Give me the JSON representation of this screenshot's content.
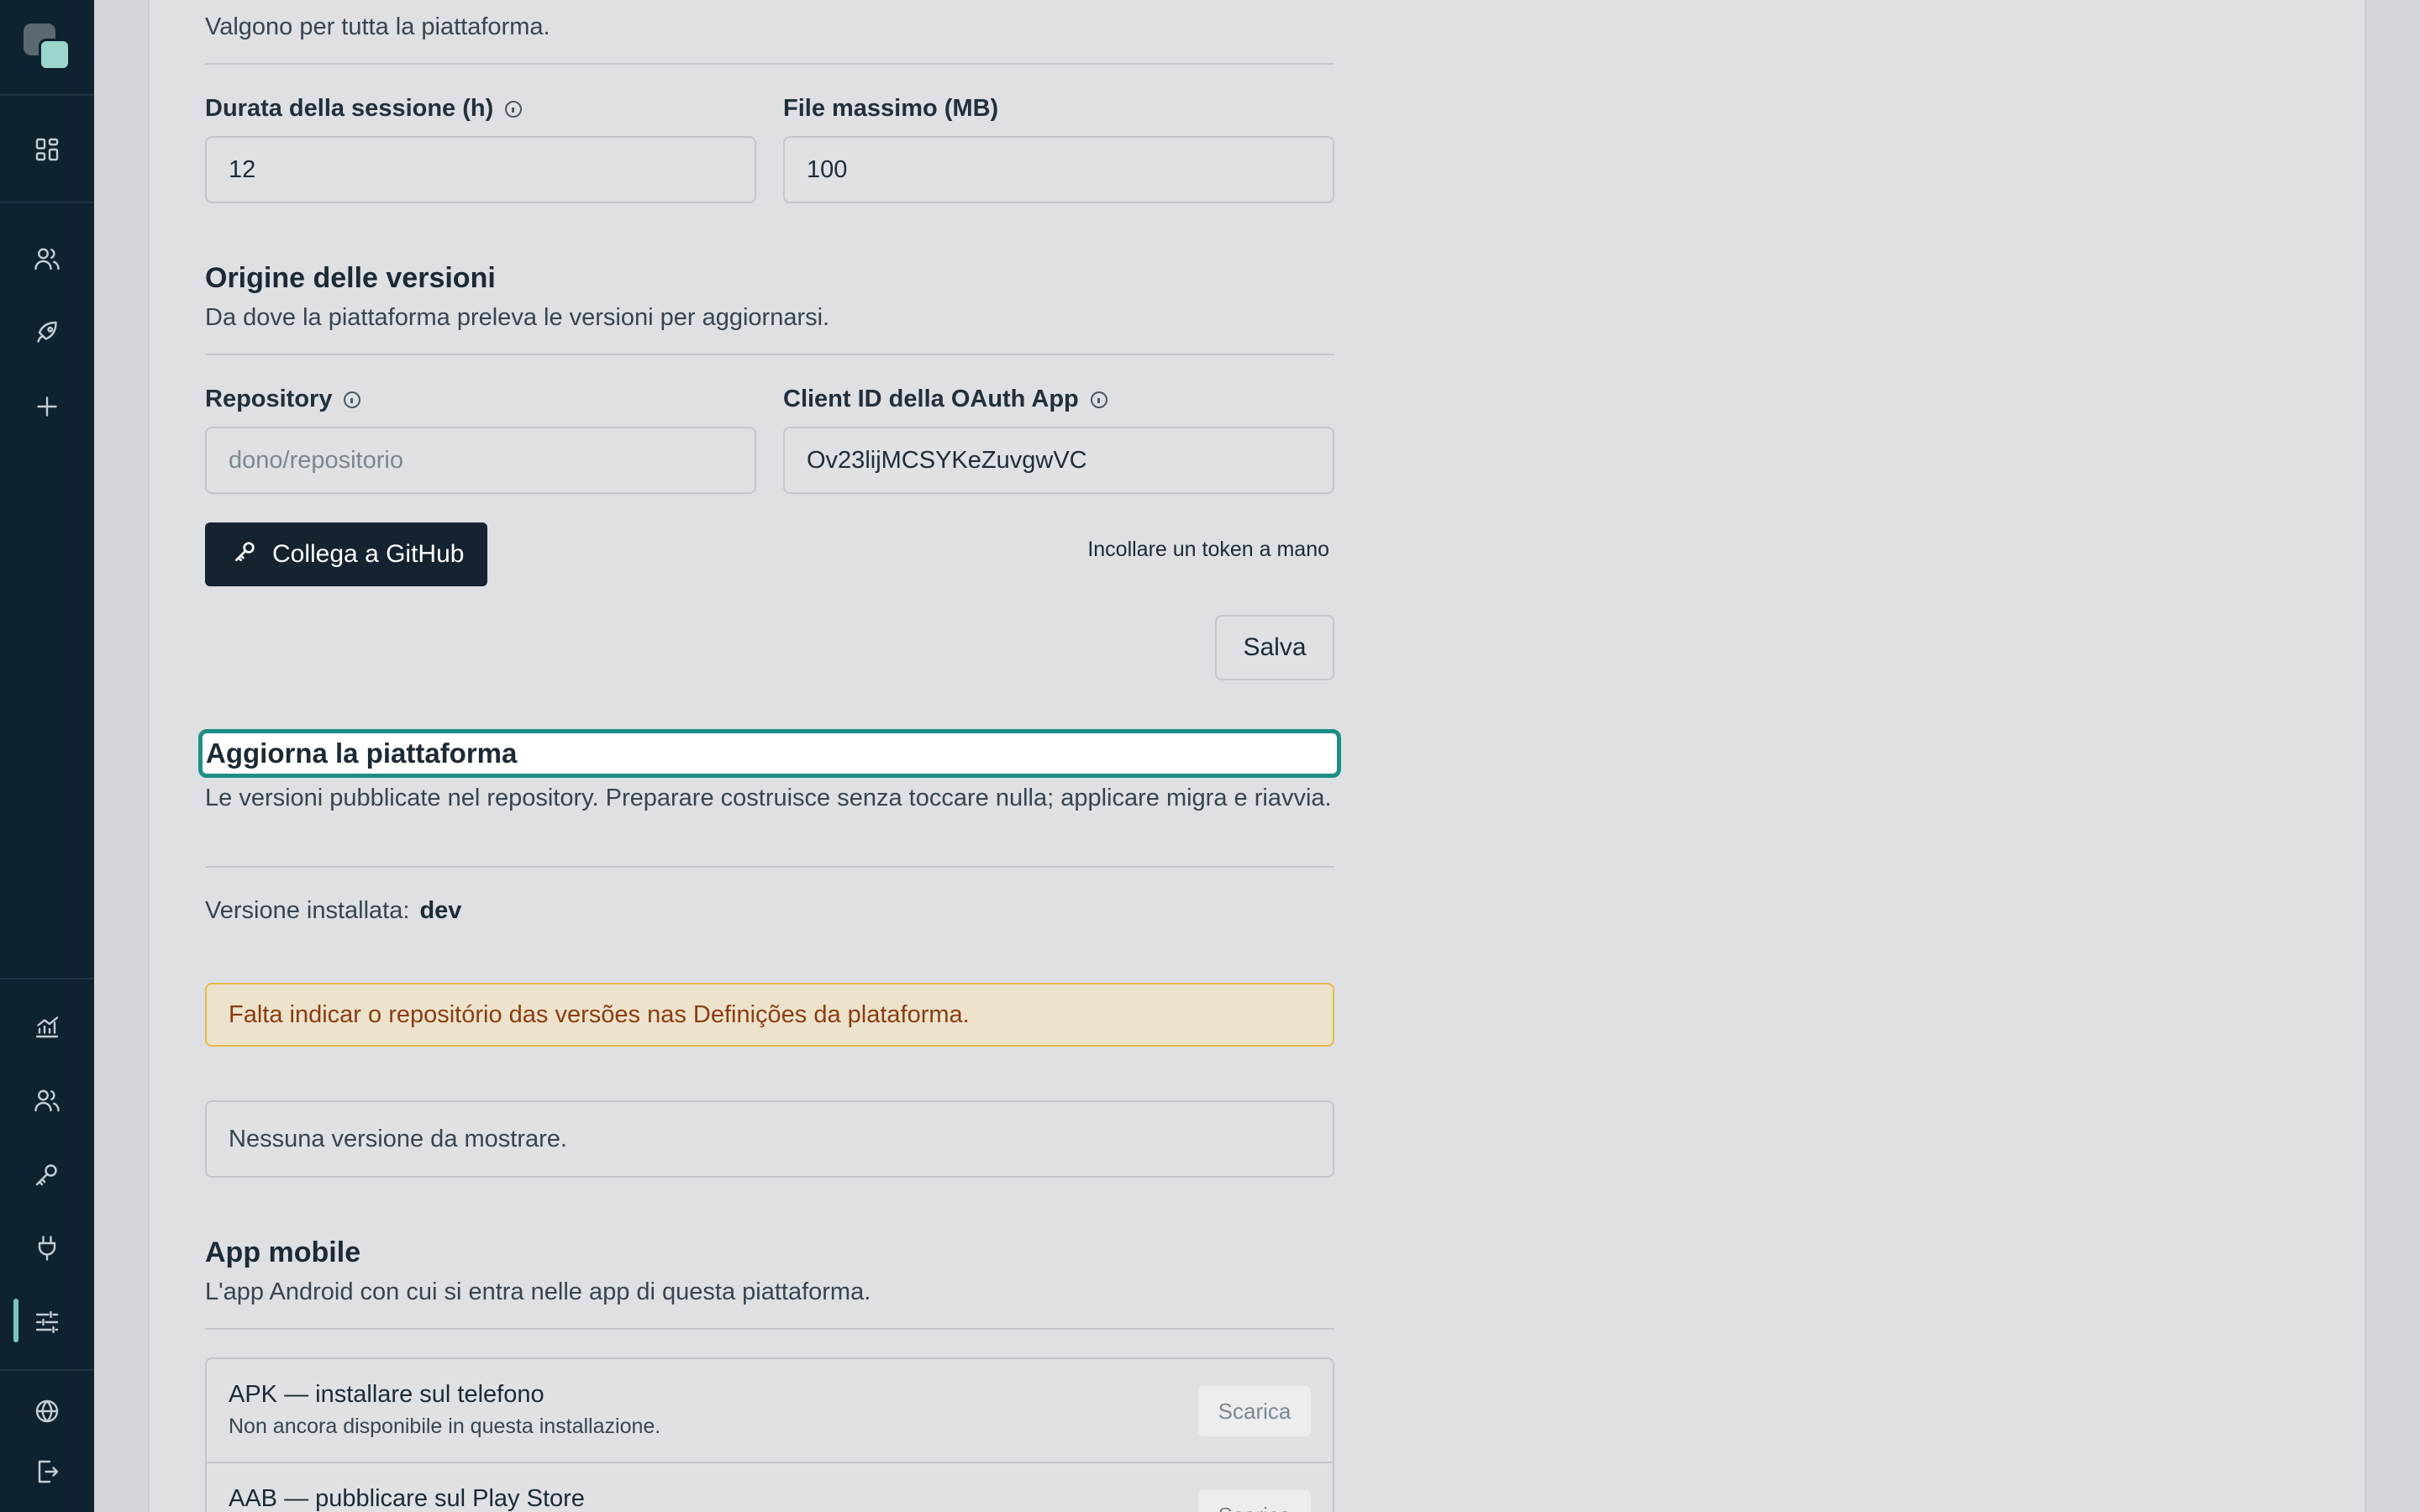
{
  "sidebar": {
    "top_items": [
      {
        "icon": "dashboard-icon"
      },
      {
        "icon": "users-icon"
      },
      {
        "icon": "rocket-icon"
      },
      {
        "icon": "plus-icon"
      }
    ],
    "bottom_items": [
      {
        "icon": "chart-icon"
      },
      {
        "icon": "users-icon"
      },
      {
        "icon": "key-icon"
      },
      {
        "icon": "plug-icon"
      },
      {
        "icon": "sliders-icon",
        "active": true
      },
      {
        "icon": "globe-icon"
      },
      {
        "icon": "logout-icon"
      }
    ]
  },
  "general": {
    "description": "Valgono per tutta la piattaforma.",
    "session_label": "Durata della sessione (h)",
    "session_value": "12",
    "file_label": "File massimo (MB)",
    "file_value": "100"
  },
  "origin": {
    "title": "Origine delle versioni",
    "description": "Da dove la piattaforma preleva le versioni per aggiornarsi.",
    "repository_label": "Repository",
    "repository_placeholder": "dono/repositorio",
    "client_id_label": "Client ID della OAuth App",
    "client_id_value": "Ov23lijMCSYKeZuvgwVC",
    "connect_button": "Collega a GitHub",
    "manual_token_link": "Incollare un token a mano",
    "save_button": "Salva"
  },
  "update": {
    "title": "Aggiorna la piattaforma",
    "description": "Le versioni pubblicate nel repository. Preparare costruisce senza toccare nulla; applicare migra e riavvia.",
    "installed_label": "Versione installata:",
    "installed_value": "dev",
    "warning": "Falta indicar o repositório das versões nas Definições da plataforma.",
    "empty_state": "Nessuna versione da mostrare."
  },
  "mobile": {
    "title": "App mobile",
    "description": "L'app Android con cui si entra nelle app di questa piattaforma.",
    "items": [
      {
        "title": "APK — installare sul telefono",
        "subtitle": "Non ancora disponibile in questa installazione.",
        "button": "Scarica"
      },
      {
        "title": "AAB — pubblicare sul Play Store",
        "subtitle": "",
        "button": "Scarica"
      }
    ]
  },
  "colors": {
    "sidebar_bg": "#0e2230",
    "accent": "#1d8e86",
    "warning_border": "#e5bb49",
    "warning_text": "#8a3d12"
  }
}
